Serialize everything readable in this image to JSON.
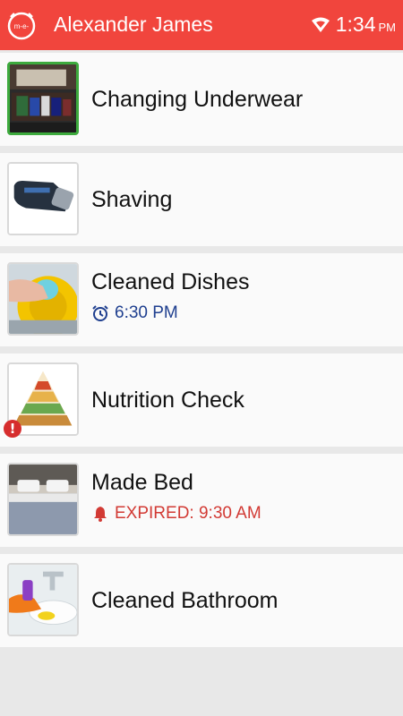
{
  "header": {
    "title": "Alexander James",
    "logo_text": "m-e-",
    "time": "1:34",
    "ampm": "PM",
    "accent_color": "#f1453d"
  },
  "tasks": [
    {
      "title": "Changing Underwear",
      "icon": "drawer-photo",
      "selected": true
    },
    {
      "title": "Shaving",
      "icon": "electric-shaver-photo"
    },
    {
      "title": "Cleaned Dishes",
      "icon": "dish-washing-photo",
      "subtitle": "6:30 PM",
      "subtitle_icon": "alarm-clock-icon"
    },
    {
      "title": "Nutrition Check",
      "icon": "food-pyramid-photo",
      "badge": "!"
    },
    {
      "title": "Made Bed",
      "icon": "bed-photo",
      "subtitle": "EXPIRED: 9:30 AM",
      "subtitle_icon": "bell-icon"
    },
    {
      "title": "Cleaned Bathroom",
      "icon": "sink-cleaning-photo"
    }
  ],
  "colors": {
    "subtitle_blue": "#1f3f8f",
    "expired_red": "#d23a34",
    "selected_border": "#3daa3d"
  }
}
